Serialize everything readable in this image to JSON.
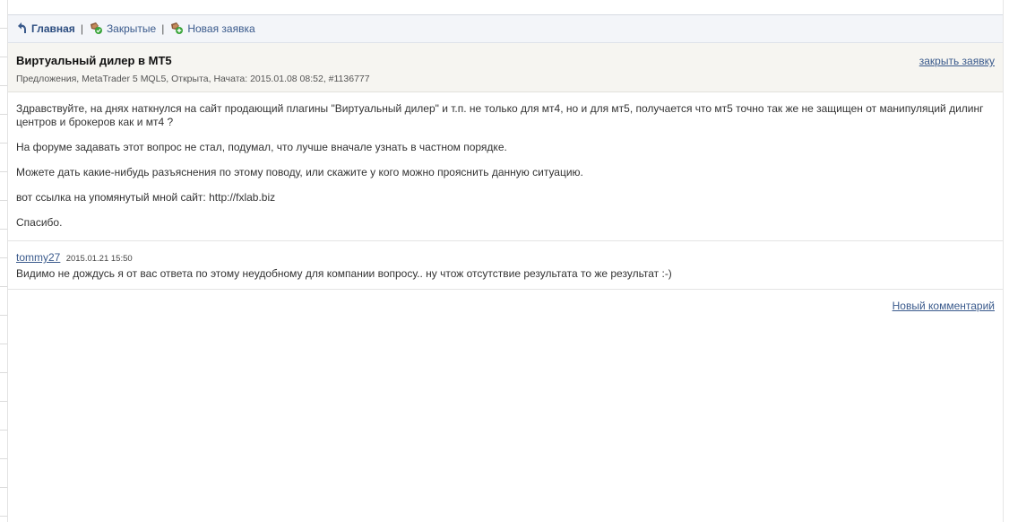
{
  "nav": {
    "home_label": "Главная",
    "closed_label": "Закрытые",
    "new_label": "Новая заявка",
    "separator": "|"
  },
  "ticket": {
    "title": "Виртуальный дилер в MT5",
    "meta": "Предложения, MetaTrader 5 MQL5, Открыта, Начата: 2015.01.08 08:52, #1136777",
    "close_label": "закрыть заявку",
    "body": [
      "Здравствуйте, на днях наткнулся на сайт продающий плагины \"Виртуальный дилер\" и т.п. не только для мт4, но и для мт5, получается что мт5 точно так же не защищен от манипуляций дилинг центров и брокеров как и мт4 ?",
      "На форуме задавать этот вопрос не стал, подумал, что лучше вначале узнать в частном порядке.",
      "Можете дать какие-нибудь разъяснения по этому поводу, или скажите у кого можно прояснить данную ситуацию.",
      "вот ссылка на упомянутый мной сайт: http://fxlab.biz",
      "Спасибо."
    ]
  },
  "comments": [
    {
      "author": "tommy27",
      "date": "2015.01.21 15:50",
      "text": "Видимо не дождусь я от вас ответа по этому неудобному для компании вопросу.. ну чтож отсутствие результата то же результат :-)"
    }
  ],
  "footer": {
    "new_comment_label": "Новый комментарий"
  },
  "icons": {
    "home": "back-arrow-icon",
    "closed": "ticket-closed-icon",
    "new": "ticket-new-icon"
  },
  "colors": {
    "link": "#3a5a8c",
    "nav_bg": "#f3f5f9",
    "header_bg": "#f6f5f1",
    "badge_green": "#3aa53a"
  }
}
